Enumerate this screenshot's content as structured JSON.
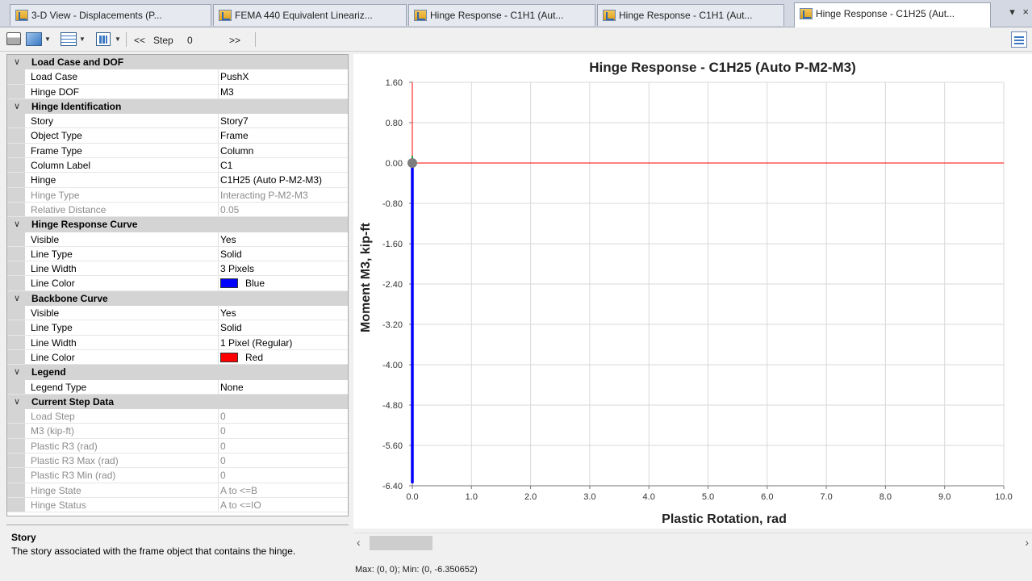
{
  "tabs": [
    {
      "label": "3-D View  - Displacements (P..."
    },
    {
      "label": "FEMA 440 Equivalent Lineariz..."
    },
    {
      "label": "Hinge Response - C1H1 (Aut..."
    },
    {
      "label": "Hinge Response - C1H1 (Aut..."
    },
    {
      "label": "Hinge Response - C1H25 (Aut..."
    }
  ],
  "tab_controls": {
    "menu": "▾",
    "close": "×"
  },
  "toolbar": {
    "prev_step": "<<",
    "step_label": "Step",
    "step_value": "0",
    "next_step": ">>"
  },
  "property_grid": {
    "chevron": "∨",
    "categories": [
      {
        "title": "Load Case and DOF",
        "rows": [
          {
            "name": "Load Case",
            "value": "PushX"
          },
          {
            "name": "Hinge DOF",
            "value": "M3"
          }
        ]
      },
      {
        "title": "Hinge Identification",
        "rows": [
          {
            "name": "Story",
            "value": "Story7"
          },
          {
            "name": "Object Type",
            "value": "Frame"
          },
          {
            "name": "Frame Type",
            "value": "Column"
          },
          {
            "name": "Column Label",
            "value": "C1"
          },
          {
            "name": "Hinge",
            "value": "C1H25 (Auto P-M2-M3)"
          },
          {
            "name": "Hinge Type",
            "value": "Interacting P-M2-M3"
          },
          {
            "name": "Relative Distance",
            "value": "0.05"
          }
        ]
      },
      {
        "title": "Hinge Response Curve",
        "rows": [
          {
            "name": "Visible",
            "value": "Yes"
          },
          {
            "name": "Line Type",
            "value": "Solid"
          },
          {
            "name": "Line Width",
            "value": "3 Pixels"
          },
          {
            "name": "Line Color",
            "value": "Blue"
          }
        ]
      },
      {
        "title": "Backbone Curve",
        "rows": [
          {
            "name": "Visible",
            "value": "Yes"
          },
          {
            "name": "Line Type",
            "value": "Solid"
          },
          {
            "name": "Line Width",
            "value": "1 Pixel (Regular)"
          },
          {
            "name": "Line Color",
            "value": "Red"
          }
        ]
      },
      {
        "title": "Legend",
        "rows": [
          {
            "name": "Legend Type",
            "value": "None"
          }
        ]
      },
      {
        "title": "Current Step Data",
        "rows": [
          {
            "name": "Load Step",
            "value": "0"
          },
          {
            "name": "M3 (kip-ft)",
            "value": "0"
          },
          {
            "name": "Plastic R3 (rad)",
            "value": "0"
          },
          {
            "name": "Plastic R3 Max (rad)",
            "value": "0"
          },
          {
            "name": "Plastic R3 Min (rad)",
            "value": "0"
          },
          {
            "name": "Hinge State",
            "value": "A to <=B"
          },
          {
            "name": "Hinge Status",
            "value": "A to <=IO"
          }
        ]
      }
    ]
  },
  "colors": {
    "response_curve": "#0000ff",
    "backbone_curve": "#ff0000",
    "origin_marker": "#7d7d7d",
    "origin_tick": "#2ea043"
  },
  "description": {
    "title": "Story",
    "text": "The story associated with the frame object that contains the hinge."
  },
  "chart_data": {
    "type": "line",
    "title": "Hinge Response - C1H25 (Auto P-M2-M3)",
    "xlabel": "Plastic Rotation, rad",
    "ylabel": "Moment M3, kip-ft",
    "xlim": [
      0.0,
      10.0
    ],
    "ylim": [
      -6.4,
      1.6
    ],
    "xticks": [
      "0.0",
      "1.0",
      "2.0",
      "3.0",
      "4.0",
      "5.0",
      "6.0",
      "7.0",
      "8.0",
      "9.0",
      "10.0"
    ],
    "yticks": [
      "1.60",
      "0.80",
      "0.00",
      "-0.80",
      "-1.60",
      "-2.40",
      "-3.20",
      "-4.00",
      "-4.80",
      "-5.60",
      "-6.40"
    ],
    "grid": true,
    "series": [
      {
        "x": [
          0.0,
          0.0
        ],
        "y": [
          0.0,
          -6.35
        ]
      },
      {
        "x": [
          0.0,
          0.0,
          10.0
        ],
        "y": [
          1.6,
          0.0,
          0.0
        ]
      }
    ],
    "marker": {
      "x": 0.0,
      "y": 0.0
    }
  },
  "status": {
    "text": "Max: (0, 0);  Min: (0, -6.350652)"
  }
}
